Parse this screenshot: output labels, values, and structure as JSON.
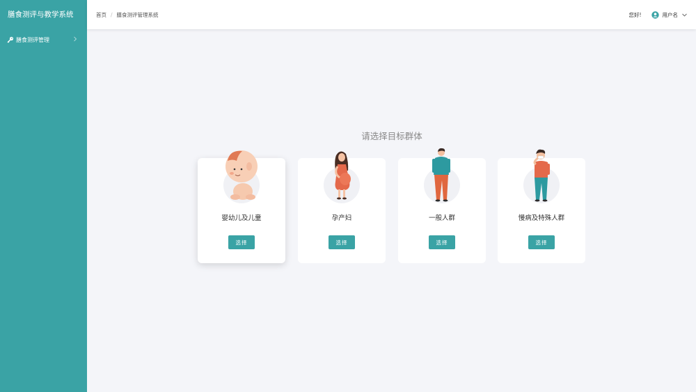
{
  "app": {
    "title": "膳食测评与教学系统"
  },
  "sidebar": {
    "items": [
      {
        "label": "膳食测评管理",
        "icon": "key-icon"
      }
    ]
  },
  "header": {
    "breadcrumb": [
      "首页",
      "膳食测评管理系统"
    ],
    "greeting": "您好!",
    "user_name": "用户名"
  },
  "main": {
    "title": "请选择目标群体",
    "groups": [
      {
        "label": "婴幼儿及儿童",
        "button": "选择",
        "icon": "baby-icon"
      },
      {
        "label": "孕产妇",
        "button": "选择",
        "icon": "pregnant-woman-icon"
      },
      {
        "label": "一般人群",
        "button": "选择",
        "icon": "man-icon"
      },
      {
        "label": "慢病及特殊人群",
        "button": "选择",
        "icon": "sick-person-icon"
      }
    ]
  },
  "colors": {
    "accent": "#3aa3a5",
    "background": "#f4f5f9"
  }
}
